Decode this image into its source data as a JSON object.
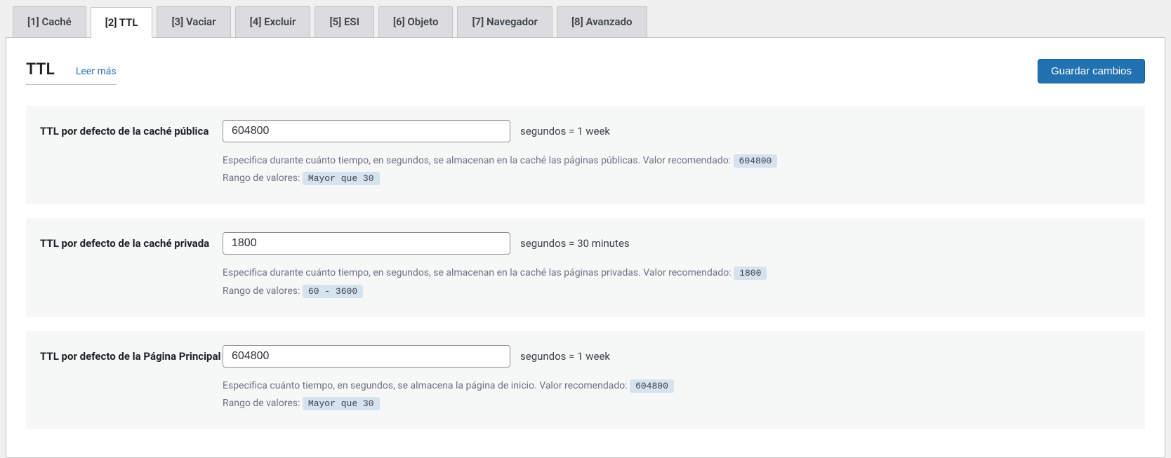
{
  "tabs": [
    {
      "label": "[1] Caché",
      "active": false
    },
    {
      "label": "[2] TTL",
      "active": true
    },
    {
      "label": "[3] Vaciar",
      "active": false
    },
    {
      "label": "[4] Excluir",
      "active": false
    },
    {
      "label": "[5] ESI",
      "active": false
    },
    {
      "label": "[6] Objeto",
      "active": false
    },
    {
      "label": "[7] Navegador",
      "active": false
    },
    {
      "label": "[8] Avanzado",
      "active": false
    }
  ],
  "heading": {
    "title": "TTL",
    "read_more": "Leer más",
    "save_button": "Guardar cambios"
  },
  "settings": [
    {
      "label": "TTL por defecto de la caché pública",
      "value": "604800",
      "unit": "segundos = 1 week",
      "desc1_pre": "Especifica durante cuánto tiempo, en segundos, se almacenan en la caché las páginas públicas. Valor recomendado: ",
      "desc1_badge": "604800",
      "desc2_pre": "Rango de valores: ",
      "desc2_badge": "Mayor que 30"
    },
    {
      "label": "TTL por defecto de la caché privada",
      "value": "1800",
      "unit": "segundos = 30 minutes",
      "desc1_pre": "Especifica durante cuánto tiempo, en segundos, se almacenan en la caché las páginas privadas. Valor recomendado: ",
      "desc1_badge": "1800",
      "desc2_pre": "Rango de valores: ",
      "desc2_badge": "60 - 3600"
    },
    {
      "label": "TTL por defecto de la Página Principal",
      "value": "604800",
      "unit": "segundos = 1 week",
      "desc1_pre": "Especifica cuánto tiempo, en segundos, se almacena la página de inicio. Valor recomendado: ",
      "desc1_badge": "604800",
      "desc2_pre": "Rango de valores: ",
      "desc2_badge": "Mayor que 30"
    }
  ]
}
